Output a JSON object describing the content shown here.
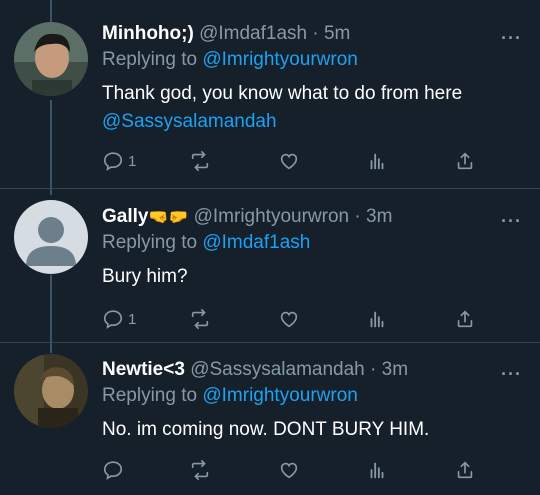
{
  "colors": {
    "background": "#15202b",
    "muted": "#8899a6",
    "link": "#1da1f2",
    "divider": "#38444d"
  },
  "tweets": [
    {
      "name": "Minhoho;)",
      "handle": "@Imdaf1ash",
      "dot": "·",
      "time": "5m",
      "replying_prefix": "Replying to",
      "replying_to": "@Imrightyourwron",
      "text": "Thank god, you know what to do from here",
      "text_mention": "@Sassysalamandah",
      "reply_count": "1",
      "avatar": "photo-avatar"
    },
    {
      "name": "Gally",
      "name_emoji": "🤜🤛",
      "handle": "@Imrightyourwron",
      "dot": "·",
      "time": "3m",
      "replying_prefix": "Replying to",
      "replying_to": "@Imdaf1ash",
      "text": "Bury him?",
      "reply_count": "1",
      "avatar": "default-avatar"
    },
    {
      "name": "Newtie<3",
      "handle": "@Sassysalamandah",
      "dot": "·",
      "time": "3m",
      "replying_prefix": "Replying to",
      "replying_to": "@Imrightyourwron",
      "text": "No. im coming now. DONT BURY HIM.",
      "reply_count": "",
      "avatar": "photo-avatar"
    }
  ],
  "icons": [
    "reply-icon",
    "retweet-icon",
    "like-icon",
    "analytics-icon",
    "share-icon",
    "more-icon"
  ],
  "more_label": "···"
}
